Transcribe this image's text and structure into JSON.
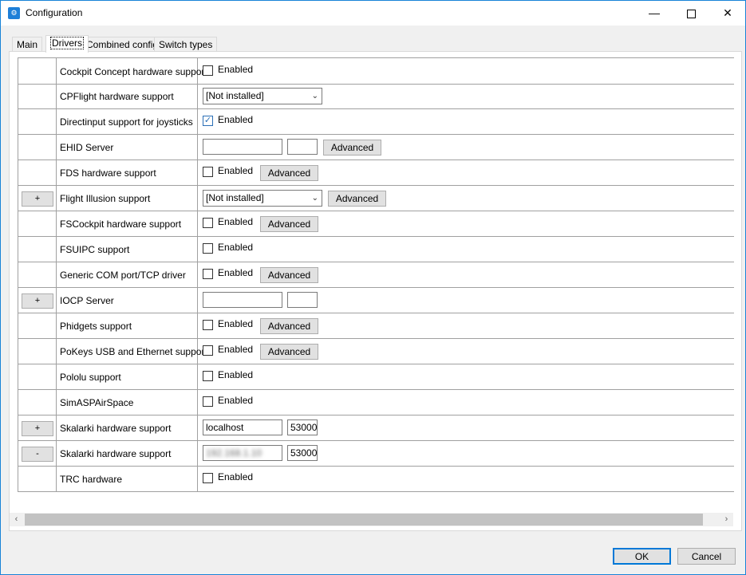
{
  "window": {
    "title": "Configuration",
    "icon": "gear-app-icon",
    "controls": {
      "minimize": "—",
      "close": "✕"
    }
  },
  "tabs": [
    {
      "label": "Main",
      "active": false
    },
    {
      "label": "Drivers",
      "active": true
    },
    {
      "label": "Combined config",
      "active": false
    },
    {
      "label": "Switch types",
      "active": false
    }
  ],
  "rows": [
    {
      "label": "Cockpit Concept hardware support",
      "enabled_label": "Enabled",
      "checked": false
    },
    {
      "label": "CPFlight hardware support",
      "combo": "[Not installed]"
    },
    {
      "label": "Directinput support for joysticks",
      "enabled_label": "Enabled",
      "checked": true
    },
    {
      "label": "EHID Server",
      "text1": "",
      "text2": "",
      "advanced": "Advanced"
    },
    {
      "label": "FDS hardware support",
      "enabled_label": "Enabled",
      "checked": false,
      "advanced": "Advanced"
    },
    {
      "label": "Flight Illusion support",
      "expander": "+",
      "combo": "[Not installed]",
      "advanced": "Advanced"
    },
    {
      "label": "FSCockpit hardware support",
      "enabled_label": "Enabled",
      "checked": false,
      "advanced": "Advanced"
    },
    {
      "label": "FSUIPC support",
      "enabled_label": "Enabled",
      "checked": false
    },
    {
      "label": "Generic COM port/TCP driver",
      "enabled_label": "Enabled",
      "checked": false,
      "advanced": "Advanced"
    },
    {
      "label": "IOCP Server",
      "expander": "+",
      "text1": "",
      "text2": ""
    },
    {
      "label": "Phidgets support",
      "enabled_label": "Enabled",
      "checked": false,
      "advanced": "Advanced"
    },
    {
      "label": "PoKeys USB and Ethernet support",
      "enabled_label": "Enabled",
      "checked": false,
      "advanced": "Advanced"
    },
    {
      "label": "Pololu support",
      "enabled_label": "Enabled",
      "checked": false
    },
    {
      "label": "SimASPAirSpace",
      "enabled_label": "Enabled",
      "checked": false
    },
    {
      "label": "Skalarki hardware support",
      "expander": "+",
      "text1": "localhost",
      "text2": "53000"
    },
    {
      "label": "Skalarki hardware support",
      "expander": "-",
      "text1": "192.168.1.10",
      "text1_blurred": true,
      "text2": "53000"
    },
    {
      "label": "TRC hardware",
      "enabled_label": "Enabled",
      "checked": false
    }
  ],
  "scrollbar": {
    "left_arrow": "‹",
    "right_arrow": "›"
  },
  "buttons": {
    "ok": "OK",
    "cancel": "Cancel"
  },
  "colors": {
    "accent": "#0078d7",
    "border": "#a0a0a0",
    "button_bg": "#e1e1e1"
  }
}
